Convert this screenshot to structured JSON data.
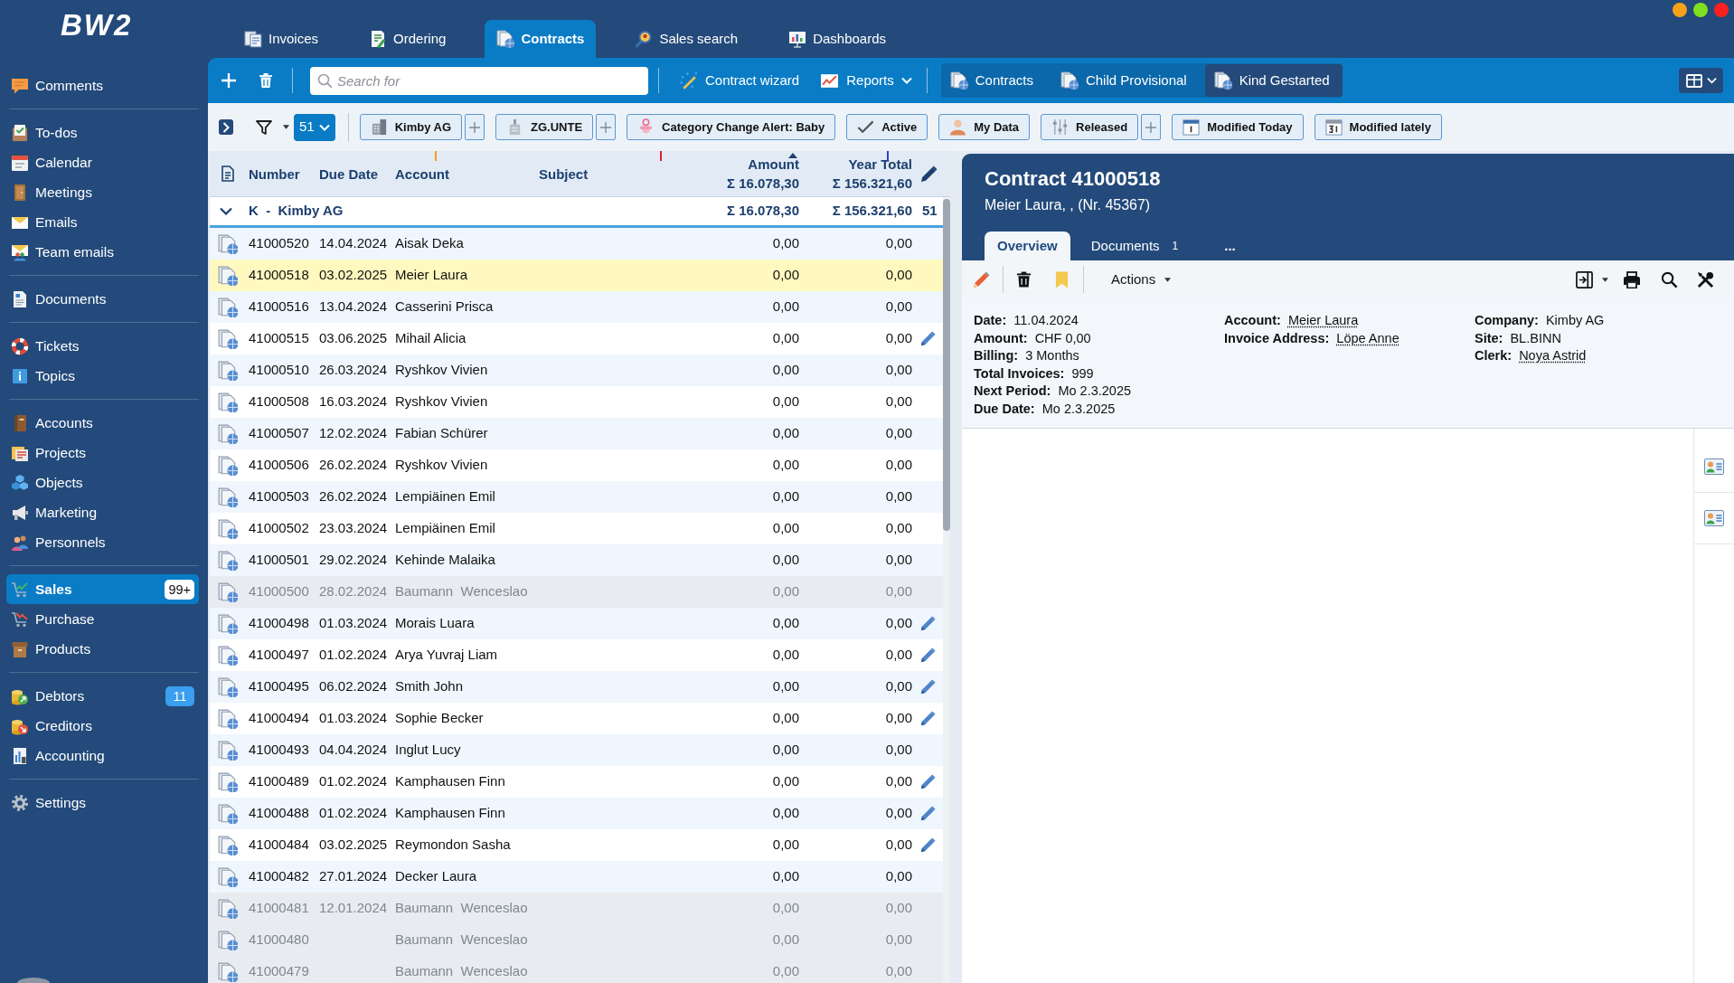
{
  "logo": "BW2",
  "sidebar": {
    "groups": [
      {
        "items": [
          {
            "label": "Comments",
            "selected": false
          }
        ]
      },
      {
        "items": [
          {
            "label": "To-dos",
            "selected": false
          },
          {
            "label": "Calendar",
            "selected": false
          },
          {
            "label": "Meetings",
            "selected": false
          },
          {
            "label": "Emails",
            "selected": false
          },
          {
            "label": "Team emails",
            "selected": false
          }
        ]
      },
      {
        "items": [
          {
            "label": "Documents",
            "selected": false
          }
        ]
      },
      {
        "items": [
          {
            "label": "Tickets",
            "selected": false
          },
          {
            "label": "Topics",
            "selected": false
          }
        ]
      },
      {
        "items": [
          {
            "label": "Accounts",
            "selected": false
          },
          {
            "label": "Projects",
            "selected": false
          },
          {
            "label": "Objects",
            "selected": false
          },
          {
            "label": "Marketing",
            "selected": false
          },
          {
            "label": "Personnels",
            "selected": false
          }
        ]
      },
      {
        "items": [
          {
            "label": "Sales",
            "selected": true,
            "badge": "99+"
          },
          {
            "label": "Purchase",
            "selected": false
          },
          {
            "label": "Products",
            "selected": false
          }
        ]
      },
      {
        "items": [
          {
            "label": "Debtors",
            "selected": false,
            "badge": "11"
          },
          {
            "label": "Creditors",
            "selected": false
          },
          {
            "label": "Accounting",
            "selected": false
          }
        ]
      },
      {
        "items": [
          {
            "label": "Settings",
            "selected": false
          }
        ]
      }
    ]
  },
  "module_tabs": [
    {
      "label": "Invoices",
      "selected": false
    },
    {
      "label": "Ordering",
      "selected": false
    },
    {
      "label": "Contracts",
      "selected": true
    },
    {
      "label": "Sales search",
      "selected": false
    },
    {
      "label": "Dashboards",
      "selected": false
    }
  ],
  "toolbar": {
    "search": {
      "placeholder": "Search for"
    },
    "actions": [
      {
        "label": "Contract wizard",
        "dropdown": false
      },
      {
        "label": "Reports",
        "dropdown": true
      }
    ],
    "views": [
      {
        "label": "Contracts",
        "selected": false
      },
      {
        "label": "Child Provisional",
        "selected": false
      },
      {
        "label": "Kind Gestarted",
        "selected": true
      }
    ]
  },
  "filter_bar": {
    "count": "51",
    "items": [
      {
        "kind": "chip",
        "label": "Kimby AG"
      },
      {
        "kind": "add"
      },
      {
        "kind": "chip",
        "label": "ZG.UNTE"
      },
      {
        "kind": "add"
      },
      {
        "kind": "chip",
        "label": "Category Change Alert: Baby"
      },
      {
        "kind": "chip",
        "label": "Active"
      },
      {
        "kind": "chip",
        "label": "My Data"
      },
      {
        "kind": "chip",
        "label": "Released"
      },
      {
        "kind": "add"
      },
      {
        "kind": "chip",
        "label": "Modified Today"
      },
      {
        "kind": "chip",
        "label": "Modified lately"
      }
    ]
  },
  "table": {
    "columns": [
      {
        "label": "Number",
        "sorted": false
      },
      {
        "label": "Due Date",
        "sorted": false
      },
      {
        "label": "Account",
        "sorted": false
      },
      {
        "label": "Subject",
        "sorted": false
      },
      {
        "label": "Amount",
        "total": "Σ 16.078,30",
        "sorted": true
      },
      {
        "label": "Year Total",
        "total": "Σ 156.321,60",
        "sorted": false
      }
    ],
    "group": {
      "label": "K  -  Kimby AG",
      "expanded": true,
      "amount": "Σ 16.078,30",
      "year_total": "Σ 156.321,60",
      "count": "51"
    },
    "rows": [
      {
        "number": "41000520",
        "due_date": "14.04.2024",
        "account": "Aisak Deka",
        "amount": "0,00",
        "year_total": "0,00",
        "selected": false,
        "inactive": false,
        "editable": false
      },
      {
        "number": "41000518",
        "due_date": "03.02.2025",
        "account": "Meier Laura",
        "amount": "0,00",
        "year_total": "0,00",
        "selected": true,
        "inactive": false,
        "editable": false
      },
      {
        "number": "41000516",
        "due_date": "13.04.2024",
        "account": "Casserini Prisca",
        "amount": "0,00",
        "year_total": "0,00",
        "selected": false,
        "inactive": false,
        "editable": false
      },
      {
        "number": "41000515",
        "due_date": "03.06.2025",
        "account": "Mihail Alicia",
        "amount": "0,00",
        "year_total": "0,00",
        "selected": false,
        "inactive": false,
        "editable": true
      },
      {
        "number": "41000510",
        "due_date": "26.03.2024",
        "account": "Ryshkov Vivien",
        "amount": "0,00",
        "year_total": "0,00",
        "selected": false,
        "inactive": false,
        "editable": false
      },
      {
        "number": "41000508",
        "due_date": "16.03.2024",
        "account": "Ryshkov Vivien",
        "amount": "0,00",
        "year_total": "0,00",
        "selected": false,
        "inactive": false,
        "editable": false
      },
      {
        "number": "41000507",
        "due_date": "12.02.2024",
        "account": "Fabian Schürer",
        "amount": "0,00",
        "year_total": "0,00",
        "selected": false,
        "inactive": false,
        "editable": false
      },
      {
        "number": "41000506",
        "due_date": "26.02.2024",
        "account": "Ryshkov Vivien",
        "amount": "0,00",
        "year_total": "0,00",
        "selected": false,
        "inactive": false,
        "editable": false
      },
      {
        "number": "41000503",
        "due_date": "26.02.2024",
        "account": "Lempiäinen Emil",
        "amount": "0,00",
        "year_total": "0,00",
        "selected": false,
        "inactive": false,
        "editable": false
      },
      {
        "number": "41000502",
        "due_date": "23.03.2024",
        "account": "Lempiäinen Emil",
        "amount": "0,00",
        "year_total": "0,00",
        "selected": false,
        "inactive": false,
        "editable": false
      },
      {
        "number": "41000501",
        "due_date": "29.02.2024",
        "account": "Kehinde Malaika",
        "amount": "0,00",
        "year_total": "0,00",
        "selected": false,
        "inactive": false,
        "editable": false
      },
      {
        "number": "41000500",
        "due_date": "28.02.2024",
        "account": "Baumann  Wenceslao",
        "amount": "0,00",
        "year_total": "0,00",
        "selected": false,
        "inactive": true,
        "editable": false
      },
      {
        "number": "41000498",
        "due_date": "01.03.2024",
        "account": "Morais Luara",
        "amount": "0,00",
        "year_total": "0,00",
        "selected": false,
        "inactive": false,
        "editable": true
      },
      {
        "number": "41000497",
        "due_date": "01.02.2024",
        "account": "Arya Yuvraj Liam",
        "amount": "0,00",
        "year_total": "0,00",
        "selected": false,
        "inactive": false,
        "editable": true
      },
      {
        "number": "41000495",
        "due_date": "06.02.2024",
        "account": "Smith John",
        "amount": "0,00",
        "year_total": "0,00",
        "selected": false,
        "inactive": false,
        "editable": true
      },
      {
        "number": "41000494",
        "due_date": "01.03.2024",
        "account": "Sophie Becker",
        "amount": "0,00",
        "year_total": "0,00",
        "selected": false,
        "inactive": false,
        "editable": true
      },
      {
        "number": "41000493",
        "due_date": "04.04.2024",
        "account": "Inglut Lucy",
        "amount": "0,00",
        "year_total": "0,00",
        "selected": false,
        "inactive": false,
        "editable": false
      },
      {
        "number": "41000489",
        "due_date": "01.02.2024",
        "account": "Kamphausen Finn",
        "amount": "0,00",
        "year_total": "0,00",
        "selected": false,
        "inactive": false,
        "editable": true
      },
      {
        "number": "41000488",
        "due_date": "01.02.2024",
        "account": "Kamphausen Finn",
        "amount": "0,00",
        "year_total": "0,00",
        "selected": false,
        "inactive": false,
        "editable": true
      },
      {
        "number": "41000484",
        "due_date": "03.02.2025",
        "account": "Reymondon Sasha",
        "amount": "0,00",
        "year_total": "0,00",
        "selected": false,
        "inactive": false,
        "editable": true
      },
      {
        "number": "41000482",
        "due_date": "27.01.2024",
        "account": "Decker Laura",
        "amount": "0,00",
        "year_total": "0,00",
        "selected": false,
        "inactive": false,
        "editable": false
      },
      {
        "number": "41000481",
        "due_date": "12.01.2024",
        "account": "Baumann  Wenceslao",
        "amount": "0,00",
        "year_total": "0,00",
        "selected": false,
        "inactive": true,
        "editable": false
      },
      {
        "number": "41000480",
        "account": "Baumann  Wenceslao",
        "amount": "0,00",
        "year_total": "0,00",
        "selected": false,
        "inactive": true,
        "editable": false
      },
      {
        "number": "41000479",
        "account": "Baumann  Wenceslao",
        "amount": "0,00",
        "year_total": "0,00",
        "selected": false,
        "inactive": true,
        "editable": false
      }
    ]
  },
  "detail": {
    "title": "Contract 41000518",
    "subtitle": "Meier Laura, , (Nr. 45367)",
    "tabs": [
      {
        "label": "Overview",
        "selected": true
      },
      {
        "label": "Documents",
        "count": "1",
        "selected": false
      }
    ],
    "more": "...",
    "actions": {
      "label": "Actions"
    },
    "fields": [
      [
        {
          "label": "Date:",
          "value": "11.04.2024",
          "link": false
        },
        {
          "label": "Amount:",
          "value": "CHF 0,00",
          "link": false
        },
        {
          "label": "Billing:",
          "value": "3 Months",
          "link": false
        },
        {
          "label": "Total Invoices:",
          "value": "999",
          "link": false
        },
        {
          "label": "Next Period:",
          "value": "Mo 2.3.2025",
          "link": false
        },
        {
          "label": "Due Date:",
          "value": "Mo 2.3.2025",
          "link": false
        }
      ],
      [
        {
          "label": "Account:",
          "value": "Meier Laura",
          "link": true
        },
        {
          "label": "Invoice Address:",
          "value": "Löpe Anne",
          "link": true
        }
      ],
      [
        {
          "label": "Company:",
          "value": "Kimby AG",
          "link": false
        },
        {
          "label": "Site:",
          "value": "BL.BINN",
          "link": false
        },
        {
          "label": "Clerk:",
          "value": "Noya Astrid",
          "link": true
        }
      ]
    ]
  }
}
